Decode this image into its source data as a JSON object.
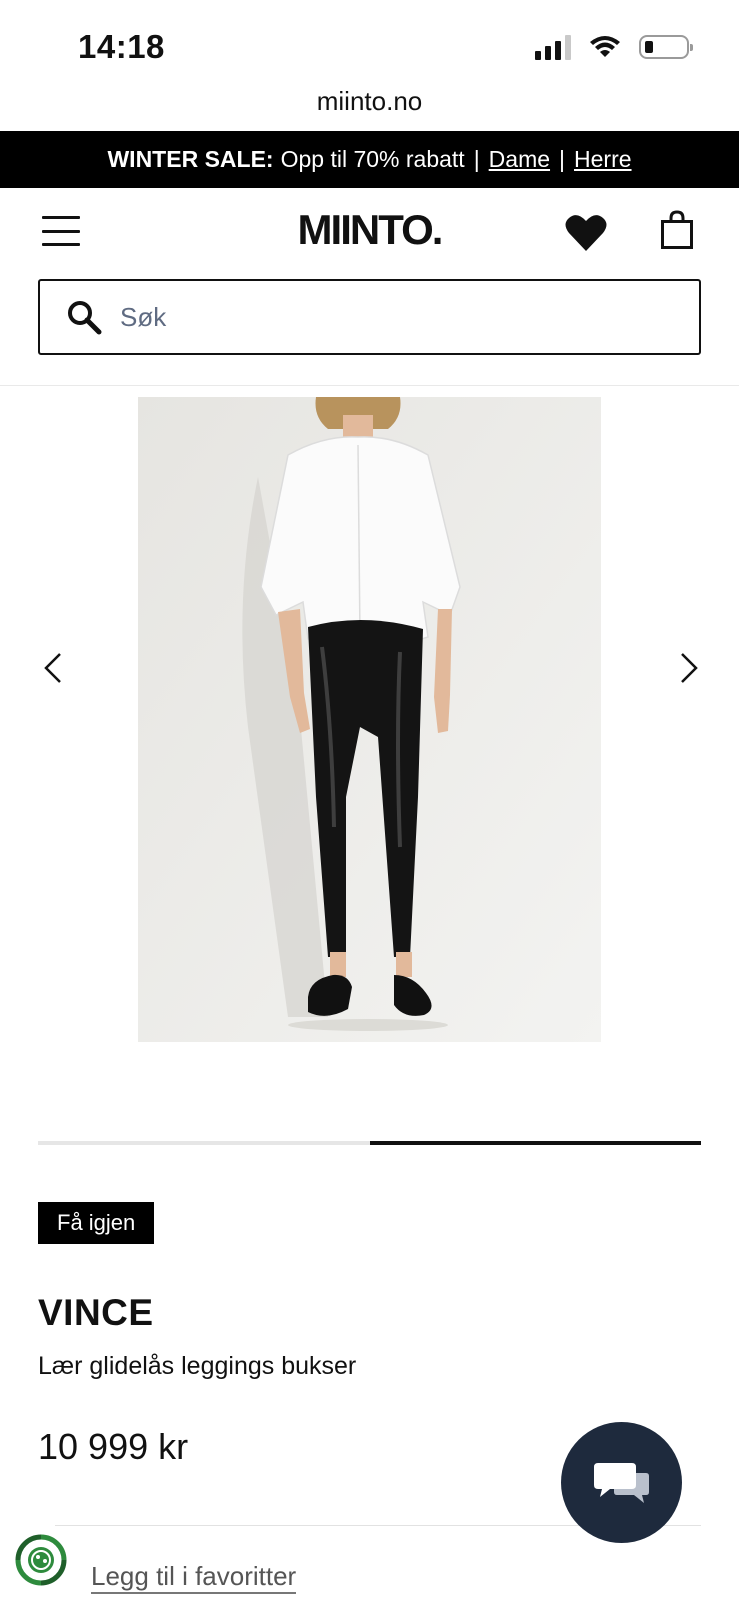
{
  "status_bar": {
    "time": "14:18",
    "icons": [
      "signal-icon",
      "wifi-icon",
      "battery-icon"
    ]
  },
  "browser": {
    "url": "miinto.no"
  },
  "promo": {
    "bold": "WINTER SALE:",
    "text": "Opp til 70% rabatt",
    "separator": "|",
    "link_women": "Dame",
    "link_men": "Herre"
  },
  "header": {
    "logo": "MIINTO.",
    "icons": [
      "menu-icon",
      "heart-icon",
      "shopping-bag-icon"
    ]
  },
  "search": {
    "placeholder": "Søk"
  },
  "gallery": {
    "image_description_icon": "product-photo",
    "current_slide": 2,
    "total_slides": 2
  },
  "product": {
    "badge": "Få igjen",
    "brand": "VINCE",
    "name": "Lær glidelås leggings bukser",
    "price": "10 999 kr",
    "favorite_link": "Legg til i favoritter"
  },
  "colors": {
    "black": "#000000",
    "chat_button": "#1e2a3d",
    "eco_green": "#2e8b3d",
    "placeholder": "#5f6b82"
  }
}
